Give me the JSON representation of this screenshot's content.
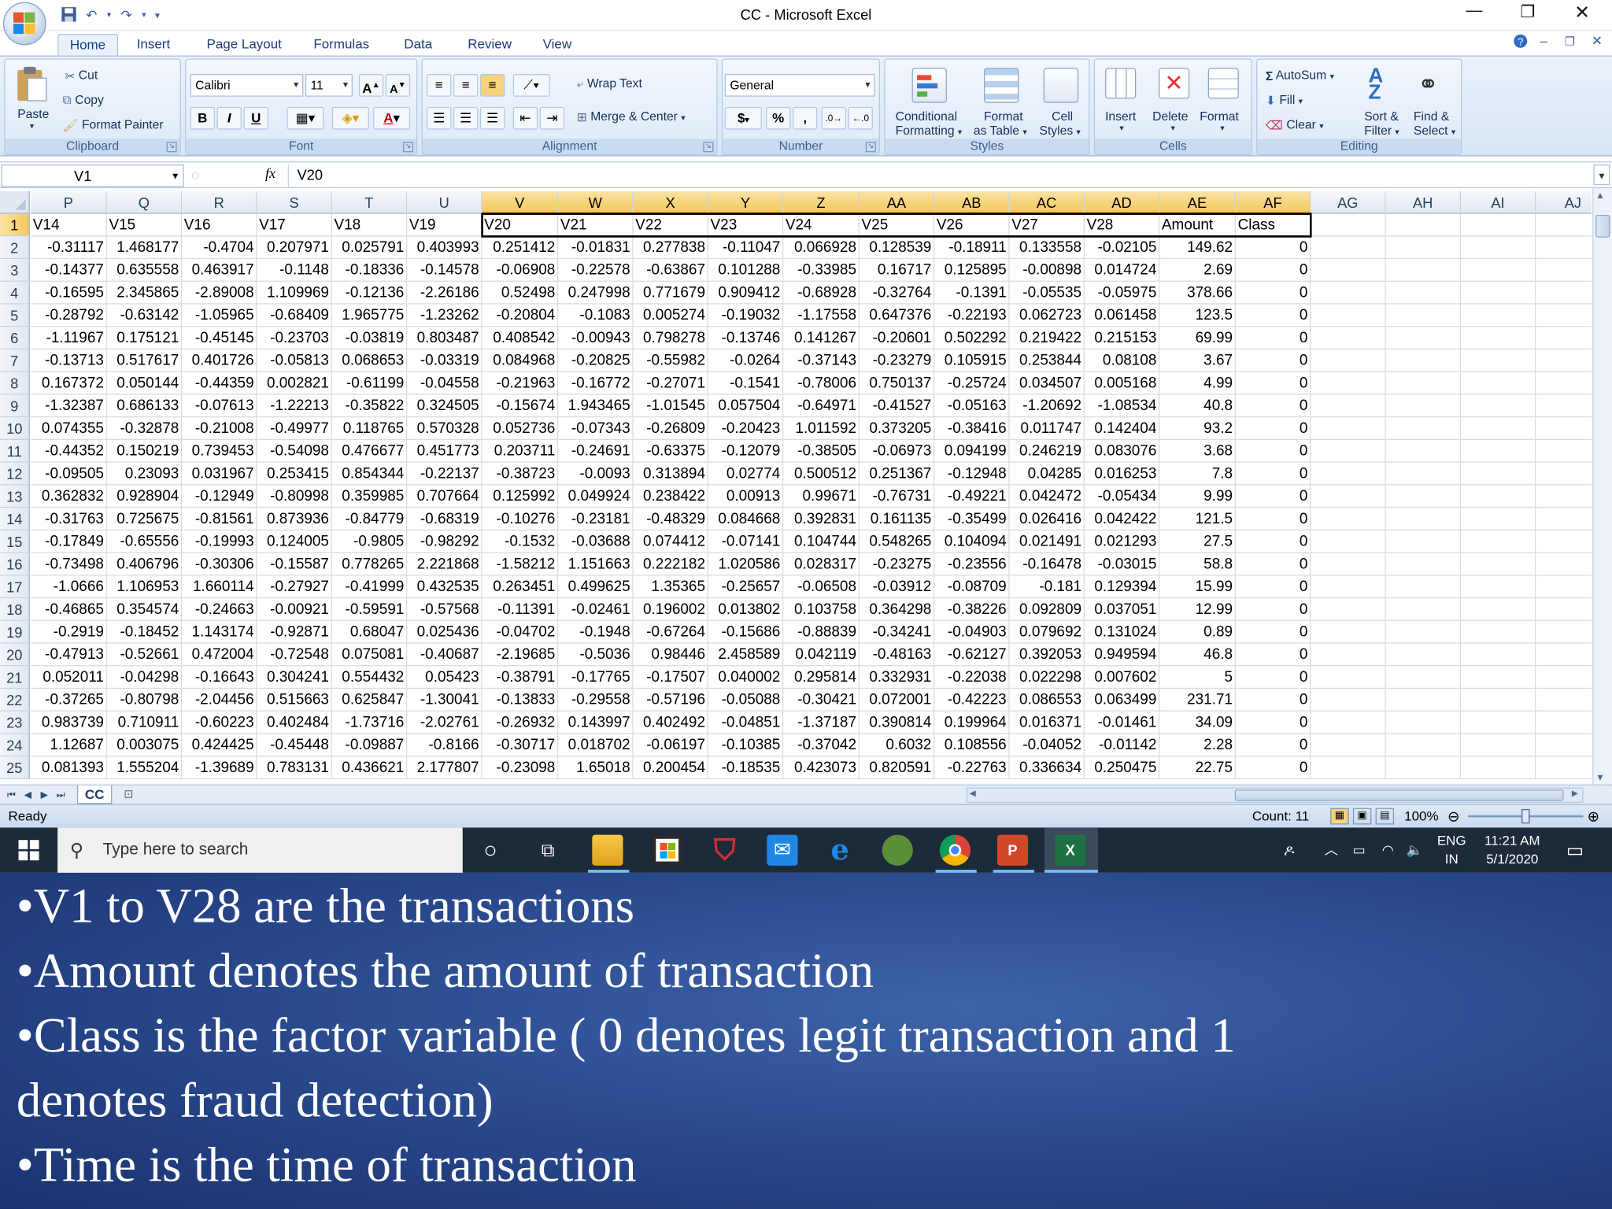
{
  "window": {
    "title": "CC - Microsoft Excel"
  },
  "ribbon": {
    "tabs": [
      "Home",
      "Insert",
      "Page Layout",
      "Formulas",
      "Data",
      "Review",
      "View"
    ],
    "active_tab": "Home",
    "clipboard": {
      "paste": "Paste",
      "cut": "Cut",
      "copy": "Copy",
      "format_painter": "Format Painter",
      "label": "Clipboard"
    },
    "font": {
      "name": "Calibri",
      "size": "11",
      "label": "Font",
      "bold": "B",
      "italic": "I",
      "underline": "U",
      "grow": "A",
      "shrink": "A",
      "font_color_letter": "A"
    },
    "alignment": {
      "wrap_text": "Wrap Text",
      "merge_center": "Merge & Center",
      "label": "Alignment"
    },
    "number": {
      "format": "General",
      "label": "Number",
      "currency": "$",
      "percent": "%",
      "comma": ","
    },
    "styles": {
      "conditional_1": "Conditional",
      "conditional_2": "Formatting",
      "format_table_1": "Format",
      "format_table_2": "as Table",
      "cell_styles_1": "Cell",
      "cell_styles_2": "Styles",
      "label": "Styles"
    },
    "cells": {
      "insert": "Insert",
      "delete": "Delete",
      "format": "Format",
      "label": "Cells"
    },
    "editing": {
      "autosum": "AutoSum",
      "fill": "Fill",
      "clear": "Clear",
      "sort_1": "Sort &",
      "sort_2": "Filter",
      "find_1": "Find &",
      "find_2": "Select",
      "label": "Editing"
    }
  },
  "formula_bar": {
    "name_box": "V1",
    "fx": "fx",
    "value": "V20"
  },
  "grid": {
    "columns": [
      "P",
      "Q",
      "R",
      "S",
      "T",
      "U",
      "V",
      "W",
      "X",
      "Y",
      "Z",
      "AA",
      "AB",
      "AC",
      "AD",
      "AE",
      "AF",
      "AG",
      "AH",
      "AI",
      "AJ"
    ],
    "rows": [
      {
        "n": "1",
        "cells": [
          "V14",
          "V15",
          "V16",
          "V17",
          "V18",
          "V19",
          "V20",
          "V21",
          "V22",
          "V23",
          "V24",
          "V25",
          "V26",
          "V27",
          "V28",
          "Amount",
          "Class"
        ]
      },
      {
        "n": "2",
        "cells": [
          "-0.31117",
          "1.468177",
          "-0.4704",
          "0.207971",
          "0.025791",
          "0.403993",
          "0.251412",
          "-0.01831",
          "0.277838",
          "-0.11047",
          "0.066928",
          "0.128539",
          "-0.18911",
          "0.133558",
          "-0.02105",
          "149.62",
          "0"
        ]
      },
      {
        "n": "3",
        "cells": [
          "-0.14377",
          "0.635558",
          "0.463917",
          "-0.1148",
          "-0.18336",
          "-0.14578",
          "-0.06908",
          "-0.22578",
          "-0.63867",
          "0.101288",
          "-0.33985",
          "0.16717",
          "0.125895",
          "-0.00898",
          "0.014724",
          "2.69",
          "0"
        ]
      },
      {
        "n": "4",
        "cells": [
          "-0.16595",
          "2.345865",
          "-2.89008",
          "1.109969",
          "-0.12136",
          "-2.26186",
          "0.52498",
          "0.247998",
          "0.771679",
          "0.909412",
          "-0.68928",
          "-0.32764",
          "-0.1391",
          "-0.05535",
          "-0.05975",
          "378.66",
          "0"
        ]
      },
      {
        "n": "5",
        "cells": [
          "-0.28792",
          "-0.63142",
          "-1.05965",
          "-0.68409",
          "1.965775",
          "-1.23262",
          "-0.20804",
          "-0.1083",
          "0.005274",
          "-0.19032",
          "-1.17558",
          "0.647376",
          "-0.22193",
          "0.062723",
          "0.061458",
          "123.5",
          "0"
        ]
      },
      {
        "n": "6",
        "cells": [
          "-1.11967",
          "0.175121",
          "-0.45145",
          "-0.23703",
          "-0.03819",
          "0.803487",
          "0.408542",
          "-0.00943",
          "0.798278",
          "-0.13746",
          "0.141267",
          "-0.20601",
          "0.502292",
          "0.219422",
          "0.215153",
          "69.99",
          "0"
        ]
      },
      {
        "n": "7",
        "cells": [
          "-0.13713",
          "0.517617",
          "0.401726",
          "-0.05813",
          "0.068653",
          "-0.03319",
          "0.084968",
          "-0.20825",
          "-0.55982",
          "-0.0264",
          "-0.37143",
          "-0.23279",
          "0.105915",
          "0.253844",
          "0.08108",
          "3.67",
          "0"
        ]
      },
      {
        "n": "8",
        "cells": [
          "0.167372",
          "0.050144",
          "-0.44359",
          "0.002821",
          "-0.61199",
          "-0.04558",
          "-0.21963",
          "-0.16772",
          "-0.27071",
          "-0.1541",
          "-0.78006",
          "0.750137",
          "-0.25724",
          "0.034507",
          "0.005168",
          "4.99",
          "0"
        ]
      },
      {
        "n": "9",
        "cells": [
          "-1.32387",
          "0.686133",
          "-0.07613",
          "-1.22213",
          "-0.35822",
          "0.324505",
          "-0.15674",
          "1.943465",
          "-1.01545",
          "0.057504",
          "-0.64971",
          "-0.41527",
          "-0.05163",
          "-1.20692",
          "-1.08534",
          "40.8",
          "0"
        ]
      },
      {
        "n": "10",
        "cells": [
          "0.074355",
          "-0.32878",
          "-0.21008",
          "-0.49977",
          "0.118765",
          "0.570328",
          "0.052736",
          "-0.07343",
          "-0.26809",
          "-0.20423",
          "1.011592",
          "0.373205",
          "-0.38416",
          "0.011747",
          "0.142404",
          "93.2",
          "0"
        ]
      },
      {
        "n": "11",
        "cells": [
          "-0.44352",
          "0.150219",
          "0.739453",
          "-0.54098",
          "0.476677",
          "0.451773",
          "0.203711",
          "-0.24691",
          "-0.63375",
          "-0.12079",
          "-0.38505",
          "-0.06973",
          "0.094199",
          "0.246219",
          "0.083076",
          "3.68",
          "0"
        ]
      },
      {
        "n": "12",
        "cells": [
          "-0.09505",
          "0.23093",
          "0.031967",
          "0.253415",
          "0.854344",
          "-0.22137",
          "-0.38723",
          "-0.0093",
          "0.313894",
          "0.02774",
          "0.500512",
          "0.251367",
          "-0.12948",
          "0.04285",
          "0.016253",
          "7.8",
          "0"
        ]
      },
      {
        "n": "13",
        "cells": [
          "0.362832",
          "0.928904",
          "-0.12949",
          "-0.80998",
          "0.359985",
          "0.707664",
          "0.125992",
          "0.049924",
          "0.238422",
          "0.00913",
          "0.99671",
          "-0.76731",
          "-0.49221",
          "0.042472",
          "-0.05434",
          "9.99",
          "0"
        ]
      },
      {
        "n": "14",
        "cells": [
          "-0.31763",
          "0.725675",
          "-0.81561",
          "0.873936",
          "-0.84779",
          "-0.68319",
          "-0.10276",
          "-0.23181",
          "-0.48329",
          "0.084668",
          "0.392831",
          "0.161135",
          "-0.35499",
          "0.026416",
          "0.042422",
          "121.5",
          "0"
        ]
      },
      {
        "n": "15",
        "cells": [
          "-0.17849",
          "-0.65556",
          "-0.19993",
          "0.124005",
          "-0.9805",
          "-0.98292",
          "-0.1532",
          "-0.03688",
          "0.074412",
          "-0.07141",
          "0.104744",
          "0.548265",
          "0.104094",
          "0.021491",
          "0.021293",
          "27.5",
          "0"
        ]
      },
      {
        "n": "16",
        "cells": [
          "-0.73498",
          "0.406796",
          "-0.30306",
          "-0.15587",
          "0.778265",
          "2.221868",
          "-1.58212",
          "1.151663",
          "0.222182",
          "1.020586",
          "0.028317",
          "-0.23275",
          "-0.23556",
          "-0.16478",
          "-0.03015",
          "58.8",
          "0"
        ]
      },
      {
        "n": "17",
        "cells": [
          "-1.0666",
          "1.106953",
          "1.660114",
          "-0.27927",
          "-0.41999",
          "0.432535",
          "0.263451",
          "0.499625",
          "1.35365",
          "-0.25657",
          "-0.06508",
          "-0.03912",
          "-0.08709",
          "-0.181",
          "0.129394",
          "15.99",
          "0"
        ]
      },
      {
        "n": "18",
        "cells": [
          "-0.46865",
          "0.354574",
          "-0.24663",
          "-0.00921",
          "-0.59591",
          "-0.57568",
          "-0.11391",
          "-0.02461",
          "0.196002",
          "0.013802",
          "0.103758",
          "0.364298",
          "-0.38226",
          "0.092809",
          "0.037051",
          "12.99",
          "0"
        ]
      },
      {
        "n": "19",
        "cells": [
          "-0.2919",
          "-0.18452",
          "1.143174",
          "-0.92871",
          "0.68047",
          "0.025436",
          "-0.04702",
          "-0.1948",
          "-0.67264",
          "-0.15686",
          "-0.88839",
          "-0.34241",
          "-0.04903",
          "0.079692",
          "0.131024",
          "0.89",
          "0"
        ]
      },
      {
        "n": "20",
        "cells": [
          "-0.47913",
          "-0.52661",
          "0.472004",
          "-0.72548",
          "0.075081",
          "-0.40687",
          "-2.19685",
          "-0.5036",
          "0.98446",
          "2.458589",
          "0.042119",
          "-0.48163",
          "-0.62127",
          "0.392053",
          "0.949594",
          "46.8",
          "0"
        ]
      },
      {
        "n": "21",
        "cells": [
          "0.052011",
          "-0.04298",
          "-0.16643",
          "0.304241",
          "0.554432",
          "0.05423",
          "-0.38791",
          "-0.17765",
          "-0.17507",
          "0.040002",
          "0.295814",
          "0.332931",
          "-0.22038",
          "0.022298",
          "0.007602",
          "5",
          "0"
        ]
      },
      {
        "n": "22",
        "cells": [
          "-0.37265",
          "-0.80798",
          "-2.04456",
          "0.515663",
          "0.625847",
          "-1.30041",
          "-0.13833",
          "-0.29558",
          "-0.57196",
          "-0.05088",
          "-0.30421",
          "0.072001",
          "-0.42223",
          "0.086553",
          "0.063499",
          "231.71",
          "0"
        ]
      },
      {
        "n": "23",
        "cells": [
          "0.983739",
          "0.710911",
          "-0.60223",
          "0.402484",
          "-1.73716",
          "-2.02761",
          "-0.26932",
          "0.143997",
          "0.402492",
          "-0.04851",
          "-1.37187",
          "0.390814",
          "0.199964",
          "0.016371",
          "-0.01461",
          "34.09",
          "0"
        ]
      },
      {
        "n": "24",
        "cells": [
          "1.12687",
          "0.003075",
          "0.424425",
          "-0.45448",
          "-0.09887",
          "-0.8166",
          "-0.30717",
          "0.018702",
          "-0.06197",
          "-0.10385",
          "-0.37042",
          "0.6032",
          "0.108556",
          "-0.04052",
          "-0.01142",
          "2.28",
          "0"
        ]
      },
      {
        "n": "25",
        "cells": [
          "0.081393",
          "1.555204",
          "-1.39689",
          "0.783131",
          "0.436621",
          "2.177807",
          "-0.23098",
          "1.65018",
          "0.200454",
          "-0.18535",
          "0.423073",
          "0.820591",
          "-0.22763",
          "0.336634",
          "0.250475",
          "22.75",
          "0"
        ]
      }
    ]
  },
  "sheet_tabs": [
    "CC"
  ],
  "status": {
    "ready": "Ready",
    "count": "Count: 11",
    "zoom": "100%"
  },
  "taskbar": {
    "search_placeholder": "Type here to search",
    "lang_1": "ENG",
    "lang_2": "IN",
    "time": "11:21 AM",
    "date": "5/1/2020"
  },
  "slide": {
    "bullets": [
      "•V1 to V28 are the transactions",
      "•Amount denotes the amount of transaction",
      "•Class is the factor variable ( 0 denotes legit transaction and 1",
      "denotes fraud detection)",
      "•Time is the time of transaction"
    ]
  },
  "colors": {
    "selected_header": "#f5c95c",
    "slide_bg": "#28478a",
    "taskbar_bg": "#1c2a3a"
  }
}
